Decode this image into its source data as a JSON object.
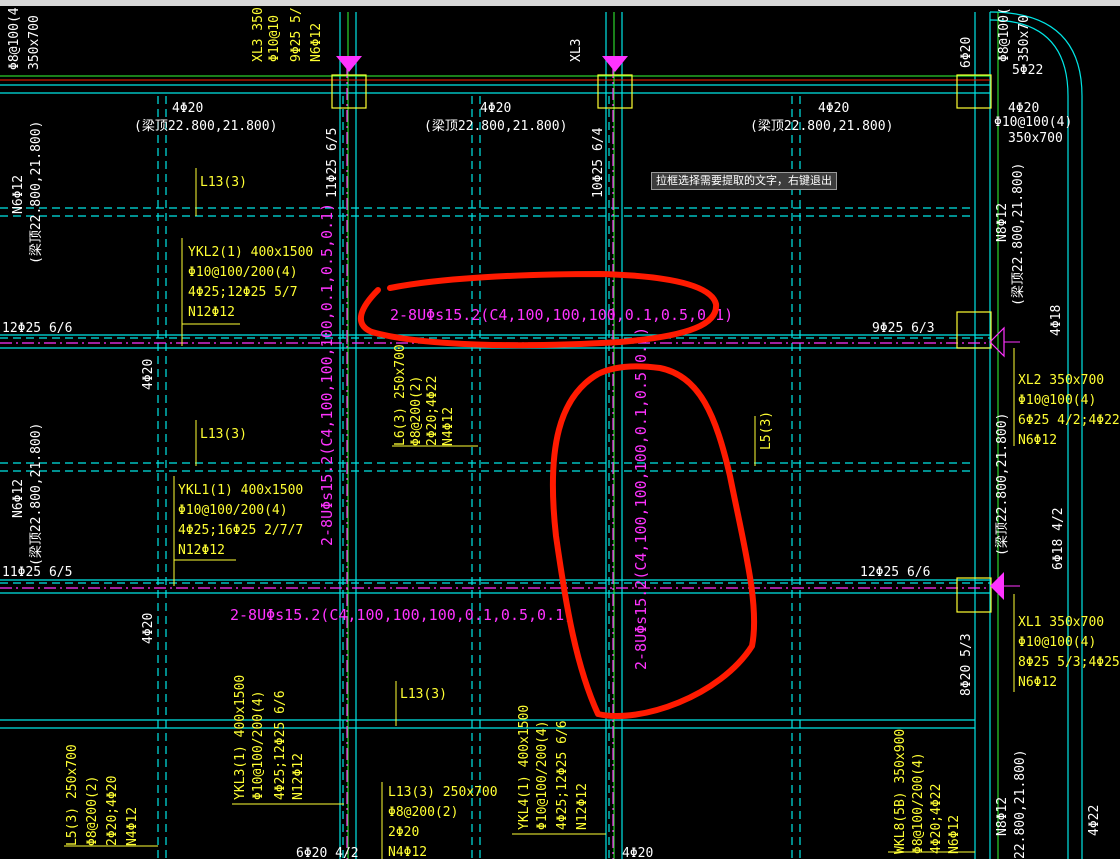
{
  "tooltip": "拉框选择需要提取的文字，右键退出",
  "labels": {
    "xl3_top": "XL3 350",
    "xl3_top_stirrup": "Φ10@10",
    "xl3_top_main": "9Φ25 5/",
    "xl3_top_waist": "N6Φ12",
    "left_top_1": "Φ8@100(4)",
    "left_top_2": "350x700",
    "xl3_mid": "XL3",
    "right_top_1": "Φ8@100(",
    "right_top_2": "350x70",
    "top_4phi20_a": "4Φ20",
    "beam_elev_a": "(梁顶22.800,21.800)",
    "top_4phi20_b": "4Φ20",
    "beam_elev_b": "(梁顶22.800,21.800)",
    "top_4phi20_c": "4Φ20",
    "beam_elev_c": "(梁顶22.800,21.800)",
    "right_6phi20": "6Φ20",
    "right_5phi22": "5Φ22",
    "right_4phi20": "4Φ20",
    "right_xl_stirrup": "Φ10@100(4)",
    "right_xl_size": "350x700",
    "left_n6_1": "N6Φ12",
    "left_elev_1": "(梁顶22.800,21.800)",
    "v_11phi25": "11Φ25 6/5",
    "v_10phi25": "10Φ25 6/4",
    "l13_a": "L13(3)",
    "ykl2_name": "YKL2(1) 400x1500",
    "ykl2_stirrup": "Φ10@100/200(4)",
    "ykl2_main": "4Φ25;12Φ25 5/7",
    "ykl2_waist": "N12Φ12",
    "right_n8": "N8Φ12",
    "right_elev_1": "(梁顶22.800,21.800)",
    "right_4phi18": "4Φ18",
    "prestress_h1": "2-8UΦs15.2(C4,100,100,100,0.1,0.5,0.1)",
    "left_12phi25": "12Φ25 6/6",
    "right_9phi25": "9Φ25 6/3",
    "prestress_v1": "2-8UΦs15.2(C4,100,100,100,0.1,0.5,0.1)",
    "v_4phi20_left": "4Φ20",
    "l6_name": "L6(3) 250x700",
    "l6_stirrup": "Φ8@200(2)",
    "l6_main": "2Φ20;4Φ22",
    "l6_waist": "N4Φ12",
    "xl2_name": "XL2 350x700",
    "xl2_stirrup": "Φ10@100(4)",
    "xl2_main": "6Φ25 4/2;4Φ22",
    "xl2_waist": "N6Φ12",
    "l13_b": "L13(3)",
    "l5": "L5(3)",
    "prestress_v2": "2-8UΦs15.2(C4,100,100,100,0.1,0.5,0.1)",
    "left_n6_2": "N6Φ12",
    "left_elev_2": "(梁顶22.800,21.800)",
    "ykl1_name": "YKL1(1) 400x1500",
    "ykl1_stirrup": "Φ10@100/200(4)",
    "ykl1_main": "4Φ25;16Φ25 2/7/7",
    "ykl1_waist": "N12Φ12",
    "right_elev_2": "(梁顶22.800,21.800)",
    "right_6phi18": "6Φ18 4/2",
    "left_11phi25": "11Φ25 6/5",
    "right_12phi25": "12Φ25 6/6",
    "prestress_h2": "2-8UΦs15.2(C4,100,100,100,0.1,0.5,0.1)",
    "v_4phi20_b": "4Φ20",
    "xl1_name": "XL1 350x700",
    "xl1_stirrup": "Φ10@100(4)",
    "xl1_main": "8Φ25 5/3;4Φ25",
    "xl1_waist": "N6Φ12",
    "right_8phi20": "8Φ20 5/3",
    "l13_c": "L13(3)",
    "ykl3_name": "YKL3(1) 400x1500",
    "ykl3_stirrup": "Φ10@100/200(4)",
    "ykl3_main": "4Φ25;12Φ25 6/6",
    "ykl3_waist": "N12Φ12",
    "ykl4_name": "YKL4(1) 400x1500",
    "ykl4_stirrup": "Φ10@100/200(4)",
    "ykl4_main": "4Φ25;12Φ25 6/6",
    "ykl4_waist": "N12Φ12",
    "l5b_name": "L5(3) 250x700",
    "l5b_stirrup": "Φ8@200(2)",
    "l5b_main": "2Φ20;4Φ20",
    "l5b_waist": "N4Φ12",
    "l13d_name": "L13(3) 250x700",
    "l13d_stirrup": "Φ8@200(2)",
    "l13d_main": "2Φ20",
    "l13d_waist": "N4Φ12",
    "wkl8_name": "WKL8(5B) 350x900",
    "wkl8_stirrup": "Φ8@100/200(4)",
    "wkl8_main": "4Φ20;4Φ22",
    "wkl8_waist": "N6Φ12",
    "bottom_n8": "N8Φ12",
    "bottom_elev": "22.800,21.800)",
    "bottom_4phi22": "4Φ22",
    "bottom_6phi20": "6Φ20 4/2",
    "bottom_4phi20": "4Φ20"
  },
  "colors": {
    "background": "#000000",
    "axis": "#00e5e5",
    "annotation_text": "#ffff33",
    "prestress": "#ff33ff",
    "markup": "#ff1a00"
  }
}
